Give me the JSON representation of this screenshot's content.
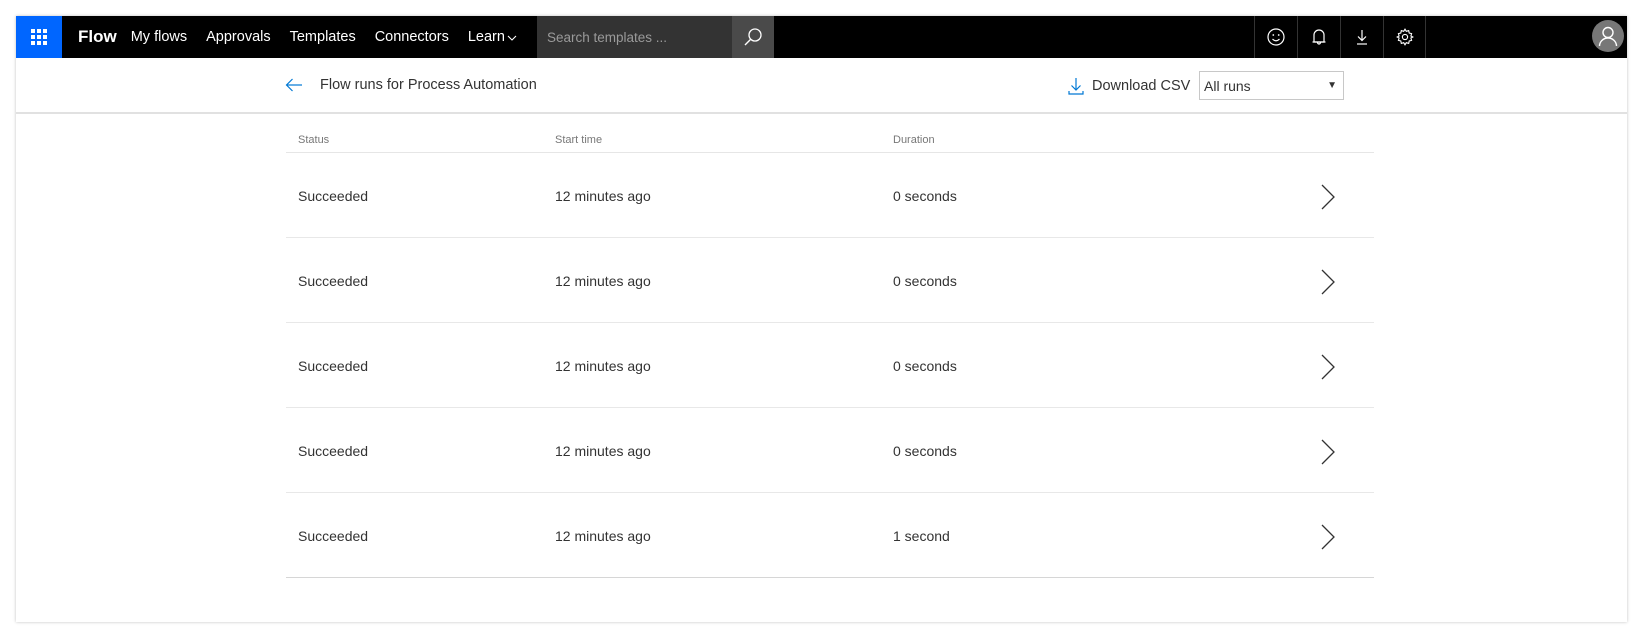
{
  "topbar": {
    "brand": "Flow",
    "nav": [
      {
        "label": "My flows"
      },
      {
        "label": "Approvals"
      },
      {
        "label": "Templates"
      },
      {
        "label": "Connectors"
      },
      {
        "label": "Learn"
      }
    ],
    "search": {
      "placeholder": "Search templates ...",
      "value": ""
    },
    "icons": [
      "smiley-icon",
      "bell-icon",
      "download-icon",
      "gear-icon"
    ],
    "colors": {
      "waffle_bg": "#0066ff",
      "bar_bg": "#000000",
      "search_bg": "#333333"
    }
  },
  "subheader": {
    "title": "Flow runs for Process Automation",
    "download_label": "Download CSV",
    "filter": {
      "selected": "All runs"
    }
  },
  "table": {
    "columns": [
      "Status",
      "Start time",
      "Duration"
    ],
    "rows": [
      {
        "status": "Succeeded",
        "start": "12 minutes ago",
        "duration": "0 seconds"
      },
      {
        "status": "Succeeded",
        "start": "12 minutes ago",
        "duration": "0 seconds"
      },
      {
        "status": "Succeeded",
        "start": "12 minutes ago",
        "duration": "0 seconds"
      },
      {
        "status": "Succeeded",
        "start": "12 minutes ago",
        "duration": "0 seconds"
      },
      {
        "status": "Succeeded",
        "start": "12 minutes ago",
        "duration": "1 second"
      }
    ]
  },
  "accent_color": "#0078d4"
}
